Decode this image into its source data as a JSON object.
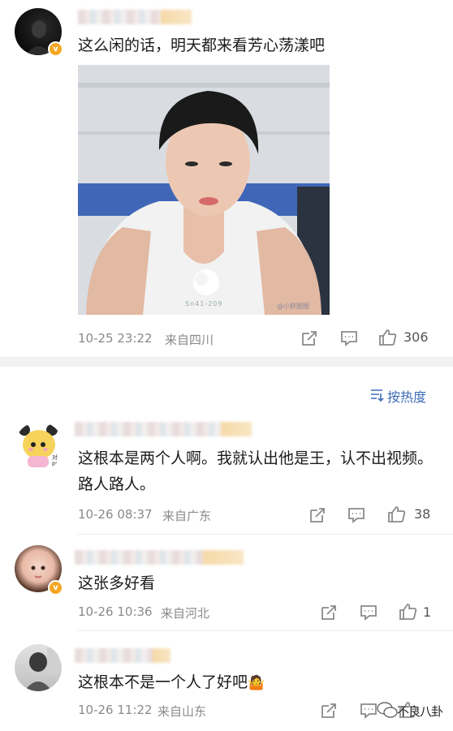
{
  "top_post": {
    "comment": "这么闲的话，明天都来看芳心荡漾吧",
    "image_watermark_left": "Sn41-209",
    "image_watermark_right": "@小胖图图",
    "time": "10-25 23:22",
    "source": "来自四川",
    "likes": "306"
  },
  "sort": {
    "label": "按热度"
  },
  "replies": [
    {
      "text": "这根本是两个人啊。我就认出他是王，认不出视频。路人路人。",
      "time": "10-26 08:37",
      "source": "来自广东",
      "likes": "38"
    },
    {
      "text": "这张多好看",
      "time": "10-26 10:36",
      "source": "来自河北",
      "likes": "1"
    },
    {
      "text": "这根本不是一个人了好吧",
      "emoji": "🤷",
      "time": "10-26 11:22",
      "source": "来自山东",
      "likes": ""
    }
  ],
  "watermark": {
    "text": "不良八卦"
  },
  "colors": {
    "badge": "#f5a623",
    "meta": "#8a8a8a",
    "sort": "#3d6cb7"
  }
}
